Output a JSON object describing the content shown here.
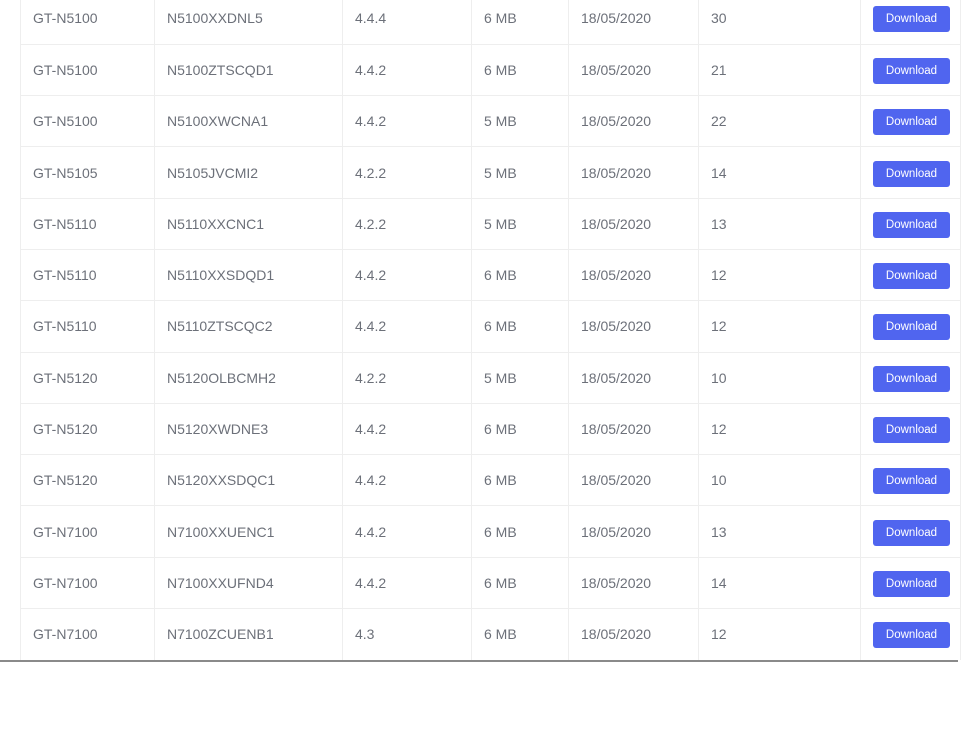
{
  "table": {
    "rows": [
      {
        "model": "GT-N5100",
        "version": "N5100XXDNL5",
        "android": "4.4.4",
        "size": "6 MB",
        "date": "18/05/2020",
        "downloads": "30",
        "action": "Download"
      },
      {
        "model": "GT-N5100",
        "version": "N5100ZTSCQD1",
        "android": "4.4.2",
        "size": "6 MB",
        "date": "18/05/2020",
        "downloads": "21",
        "action": "Download"
      },
      {
        "model": "GT-N5100",
        "version": "N5100XWCNA1",
        "android": "4.4.2",
        "size": "5 MB",
        "date": "18/05/2020",
        "downloads": "22",
        "action": "Download"
      },
      {
        "model": "GT-N5105",
        "version": "N5105JVCMI2",
        "android": "4.2.2",
        "size": "5 MB",
        "date": "18/05/2020",
        "downloads": "14",
        "action": "Download"
      },
      {
        "model": "GT-N5110",
        "version": "N5110XXCNC1",
        "android": "4.2.2",
        "size": "5 MB",
        "date": "18/05/2020",
        "downloads": "13",
        "action": "Download"
      },
      {
        "model": "GT-N5110",
        "version": "N5110XXSDQD1",
        "android": "4.4.2",
        "size": "6 MB",
        "date": "18/05/2020",
        "downloads": "12",
        "action": "Download"
      },
      {
        "model": "GT-N5110",
        "version": "N5110ZTSCQC2",
        "android": "4.4.2",
        "size": "6 MB",
        "date": "18/05/2020",
        "downloads": "12",
        "action": "Download"
      },
      {
        "model": "GT-N5120",
        "version": "N5120OLBCMH2",
        "android": "4.2.2",
        "size": "5 MB",
        "date": "18/05/2020",
        "downloads": "10",
        "action": "Download"
      },
      {
        "model": "GT-N5120",
        "version": "N5120XWDNE3",
        "android": "4.4.2",
        "size": "6 MB",
        "date": "18/05/2020",
        "downloads": "12",
        "action": "Download"
      },
      {
        "model": "GT-N5120",
        "version": "N5120XXSDQC1",
        "android": "4.4.2",
        "size": "6 MB",
        "date": "18/05/2020",
        "downloads": "10",
        "action": "Download"
      },
      {
        "model": "GT-N7100",
        "version": "N7100XXUENC1",
        "android": "4.4.2",
        "size": "6 MB",
        "date": "18/05/2020",
        "downloads": "13",
        "action": "Download"
      },
      {
        "model": "GT-N7100",
        "version": "N7100XXUFND4",
        "android": "4.4.2",
        "size": "6 MB",
        "date": "18/05/2020",
        "downloads": "14",
        "action": "Download"
      },
      {
        "model": "GT-N7100",
        "version": "N7100ZCUENB1",
        "android": "4.3",
        "size": "6 MB",
        "date": "18/05/2020",
        "downloads": "12",
        "action": "Download"
      }
    ]
  },
  "colors": {
    "accent": "#5065ef",
    "text": "#6c7079",
    "border": "#eeeeee"
  }
}
